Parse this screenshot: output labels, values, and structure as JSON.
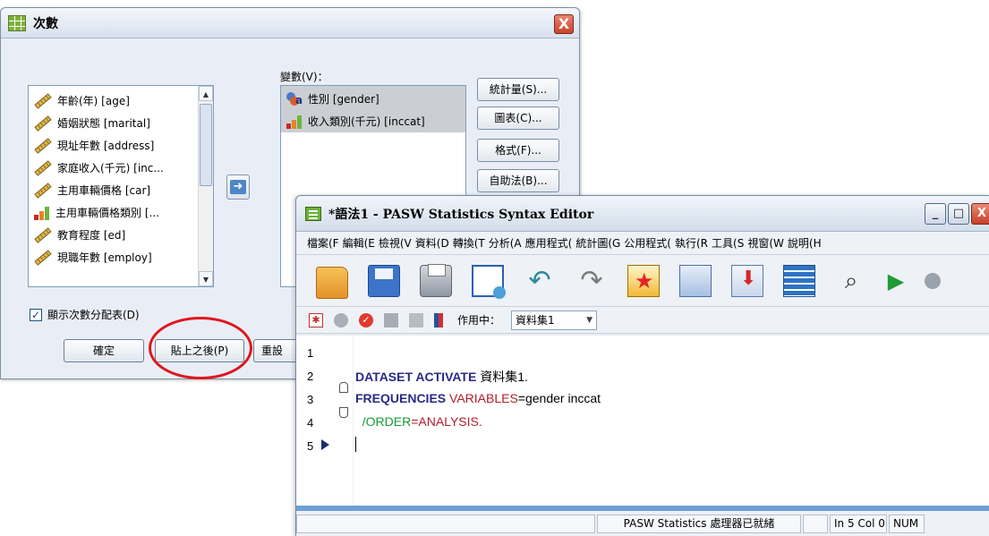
{
  "dialog": {
    "title": "次數",
    "close_label": "X",
    "variable_list": [
      {
        "label": "年齡(年) [age]",
        "icon": "scale-icon"
      },
      {
        "label": "婚姻狀態 [marital]",
        "icon": "scale-icon"
      },
      {
        "label": "現址年數 [address]",
        "icon": "scale-icon"
      },
      {
        "label": "家庭收入(千元) [inc...",
        "icon": "scale-icon"
      },
      {
        "label": "主用車輛價格 [car]",
        "icon": "scale-icon"
      },
      {
        "label": "主用車輛價格類別 [...",
        "icon": "ordinal-icon"
      },
      {
        "label": "教育程度 [ed]",
        "icon": "scale-icon"
      },
      {
        "label": "現職年數 [employ]",
        "icon": "scale-icon"
      }
    ],
    "variables_label": "變數(V)：",
    "selected_variables": [
      {
        "label": "性別 [gender]",
        "icon": "nominal-icon"
      },
      {
        "label": "收入類別(千元) [inccat]",
        "icon": "ordinal-icon"
      }
    ],
    "side_buttons": [
      "統計量(S)...",
      "圖表(C)...",
      "格式(F)...",
      "自助法(B)..."
    ],
    "checkbox_label": "顯示次數分配表(D)",
    "checkbox_checked": true,
    "ok_label": "確定",
    "paste_label": "貼上之後(P)",
    "reset_label": "重設"
  },
  "editor": {
    "title": "*語法1 - PASW Statistics Syntax Editor",
    "window_buttons": {
      "minimize": "_",
      "maximize": "□",
      "close": "X"
    },
    "menu": [
      "檔案(F",
      "編輯(E",
      "檢視(V",
      "資料(D",
      "轉換(T",
      "分析(A",
      "應用程式(",
      "統計圖(G",
      "公用程式(",
      "執行(R",
      "工具(S",
      "視窗(W",
      "說明(H"
    ],
    "active_label": "作用中：",
    "dataset_value": "資料集1",
    "lines": [
      {
        "num": "1",
        "parts": []
      },
      {
        "num": "2",
        "parts": [
          {
            "text": "DATASET ACTIVATE",
            "style": "kw"
          },
          {
            "text": " 資料集1.",
            "style": "plain"
          }
        ]
      },
      {
        "num": "3",
        "parts": [
          {
            "text": "FREQUENCIES",
            "style": "kw"
          },
          {
            "text": " VARIABLES",
            "style": "kw2"
          },
          {
            "text": "=gender inccat",
            "style": "plain"
          }
        ]
      },
      {
        "num": "4",
        "parts": [
          {
            "text": "  /ORDER",
            "style": "sub"
          },
          {
            "text": "=ANALYSIS.",
            "style": "kw2"
          }
        ]
      },
      {
        "num": "5",
        "parts": []
      }
    ],
    "status": {
      "processor": "PASW Statistics 處理器已就緒",
      "position": "In 5 Col 0",
      "num": "NUM"
    }
  }
}
